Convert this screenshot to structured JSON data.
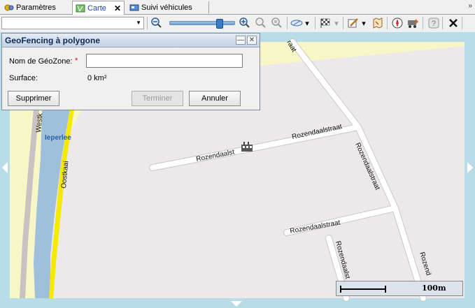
{
  "tabs": [
    {
      "label": "Paramètres",
      "icon": "settings-icon"
    },
    {
      "label": "Carte",
      "icon": "map-icon",
      "active": true
    },
    {
      "label": "Suivi véhicules",
      "icon": "vehicle-tracking-icon"
    }
  ],
  "tab_overflow": "»",
  "tab_close": "✕",
  "toolbar": {
    "combo_value": "",
    "zoom_level": 0.78,
    "icons": [
      "zoom-out-icon",
      "zoom-slider",
      "zoom-in-icon",
      "zoom-select-icon",
      "zoom-extent-icon",
      "measure-icon",
      "flag-icon",
      "edit-icon",
      "map-layers-icon",
      "compass-icon",
      "vehicle-icon",
      "help-icon",
      "close-icon"
    ]
  },
  "map": {
    "labels": {
      "westk": "Westk",
      "ieperlee": "Ieperlee",
      "oostkaai": "Oostkaai",
      "rozen1": "Rozendaalstraat",
      "rozen2": "Rozendaalst",
      "rozen3": "Rozendaalstraat",
      "rozen4": "Rozendaalstraat",
      "rozen5": "Rozendaalst",
      "rozen6": "Rozend",
      "top_raat": "raat"
    },
    "scale_label": "100m",
    "colors": {
      "water": "#9fc0dc",
      "land": "#ede9ea",
      "green": "#f7f6c6",
      "road": "#ffffff",
      "highway": "#f5e900"
    }
  },
  "dialog": {
    "title": "GeoFencing à polygone",
    "name_label": "Nom de GéoZone:",
    "required_marker": "*",
    "name_value": "",
    "surface_label": "Surface:",
    "surface_value": "0 km²",
    "buttons": {
      "delete": "Supprimer",
      "finish": "Terminer",
      "cancel": "Annuler"
    },
    "minimize_glyph": "—",
    "close_glyph": "✕"
  }
}
